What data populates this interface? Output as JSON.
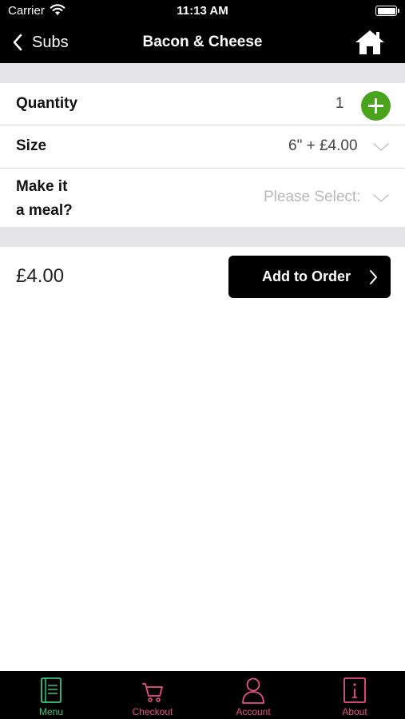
{
  "status_bar": {
    "carrier": "Carrier",
    "time": "11:13 AM"
  },
  "nav": {
    "back_label": "Subs",
    "title": "Bacon & Cheese"
  },
  "form": {
    "quantity": {
      "label": "Quantity",
      "value": "1"
    },
    "size": {
      "label": "Size",
      "value": "6\" + £4.00"
    },
    "meal": {
      "label_line1": "Make it",
      "label_line2": "a meal?",
      "placeholder": "Please Select:"
    }
  },
  "order": {
    "price": "£4.00",
    "button_label": "Add to Order"
  },
  "tab_bar": {
    "tabs": [
      {
        "label": "Menu",
        "icon": "menu-book-icon",
        "active": true
      },
      {
        "label": "Checkout",
        "icon": "cart-icon",
        "active": false
      },
      {
        "label": "Account",
        "icon": "person-icon",
        "active": false
      },
      {
        "label": "About",
        "icon": "info-icon",
        "active": false
      }
    ]
  },
  "colors": {
    "bar_background": "#000000",
    "add_button": "#4aa31d",
    "tab_active": "#3ec47a",
    "tab_inactive": "#e8508a",
    "separator_band": "#e4e4e6"
  }
}
